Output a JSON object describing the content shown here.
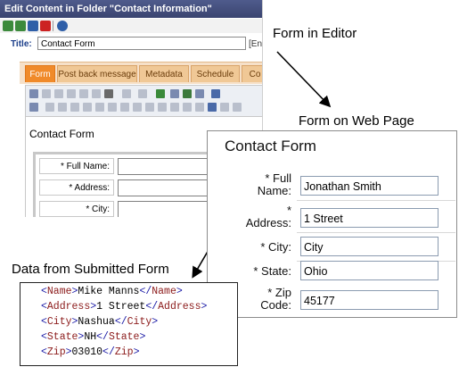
{
  "editor": {
    "window_title": "Edit Content in Folder \"Contact Information\"",
    "title_label": "Title:",
    "title_value": "Contact Form",
    "title_suffix": "[Eng",
    "tabs": [
      "Form",
      "Post back message",
      "Metadata",
      "Schedule",
      "Co"
    ],
    "active_tab": "Form",
    "content_heading": "Contact Form",
    "fields": [
      "* Full Name:",
      "* Address:",
      "* City:"
    ]
  },
  "web_form": {
    "title": "Contact Form",
    "fields": [
      {
        "label_line1": "* Full",
        "label_line2": "Name:",
        "value": "Jonathan Smith"
      },
      {
        "label_line1": "*",
        "label_line2": "Address:",
        "value": "1 Street"
      },
      {
        "label_line1": "* City:",
        "label_line2": "",
        "value": "City"
      },
      {
        "label_line1": "* State:",
        "label_line2": "",
        "value": "Ohio"
      },
      {
        "label_line1": "* Zip",
        "label_line2": "Code:",
        "value": "45177"
      }
    ]
  },
  "callouts": {
    "form_in_editor": "Form in Editor",
    "form_on_web_page": "Form on Web Page",
    "data_from_submitted": "Data from Submitted Form"
  },
  "xml_lines": [
    {
      "tag": "Name",
      "value": "Mike Manns"
    },
    {
      "tag": "Address",
      "value": "1 Street"
    },
    {
      "tag": "City",
      "value": "Nashua"
    },
    {
      "tag": "State",
      "value": "NH"
    },
    {
      "tag": "Zip",
      "value": "03010"
    }
  ],
  "colors": {
    "title_bar": "#3a4470",
    "active_tab": "#f08a2a",
    "tab": "#f0c896",
    "xml_tag": "#8b1a1a",
    "xml_bracket": "#1a1aa6"
  }
}
